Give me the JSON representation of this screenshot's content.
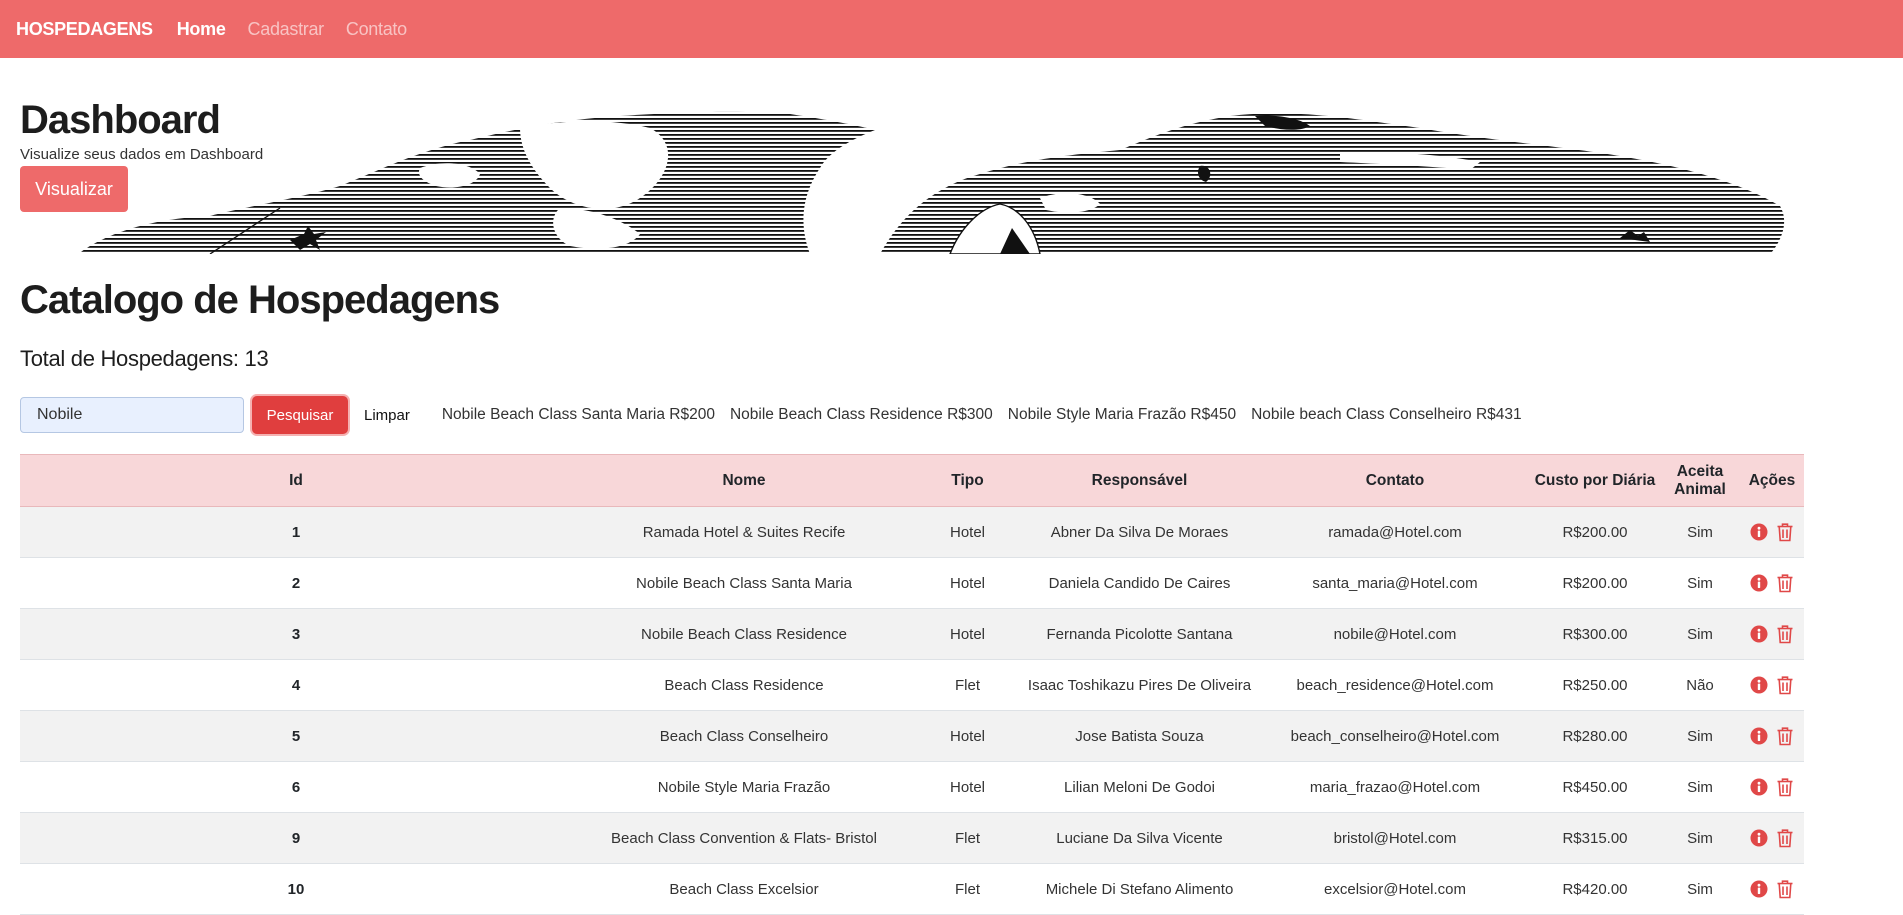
{
  "navbar": {
    "brand": "HOSPEDAGENS",
    "links": [
      {
        "label": "Home",
        "active": true
      },
      {
        "label": "Cadastrar",
        "active": false
      },
      {
        "label": "Contato",
        "active": false
      }
    ]
  },
  "dashboard": {
    "title": "Dashboard",
    "subtitle": "Visualize seus dados em Dashboard",
    "button_label": "Visualizar"
  },
  "catalog": {
    "title": "Catalogo de Hospedagens",
    "total_label": "Total de Hospedagens: 13"
  },
  "search": {
    "value": "Nobile",
    "search_button": "Pesquisar",
    "clear_button": "Limpar",
    "suggestions": [
      "Nobile Beach Class Santa Maria R$200",
      "Nobile Beach Class Residence R$300",
      "Nobile Style Maria Frazão R$450",
      "Nobile beach Class Conselheiro R$431"
    ]
  },
  "table": {
    "headers": [
      "Id",
      "Nome",
      "Tipo",
      "Responsável",
      "Contato",
      "Custo por Diária",
      "Aceita Animal",
      "Ações"
    ],
    "rows": [
      {
        "id": "1",
        "nome": "Ramada Hotel & Suites Recife",
        "tipo": "Hotel",
        "responsavel": "Abner Da Silva De Moraes",
        "contato": "ramada@Hotel.com",
        "custo": "R$200.00",
        "animal": "Sim"
      },
      {
        "id": "2",
        "nome": "Nobile Beach Class Santa Maria",
        "tipo": "Hotel",
        "responsavel": "Daniela Candido De Caires",
        "contato": "santa_maria@Hotel.com",
        "custo": "R$200.00",
        "animal": "Sim"
      },
      {
        "id": "3",
        "nome": "Nobile Beach Class Residence",
        "tipo": "Hotel",
        "responsavel": "Fernanda Picolotte Santana",
        "contato": "nobile@Hotel.com",
        "custo": "R$300.00",
        "animal": "Sim"
      },
      {
        "id": "4",
        "nome": "Beach Class Residence",
        "tipo": "Flet",
        "responsavel": "Isaac Toshikazu Pires De Oliveira",
        "contato": "beach_residence@Hotel.com",
        "custo": "R$250.00",
        "animal": "Não"
      },
      {
        "id": "5",
        "nome": "Beach Class Conselheiro",
        "tipo": "Hotel",
        "responsavel": "Jose Batista Souza",
        "contato": "beach_conselheiro@Hotel.com",
        "custo": "R$280.00",
        "animal": "Sim"
      },
      {
        "id": "6",
        "nome": "Nobile Style Maria Frazão",
        "tipo": "Hotel",
        "responsavel": "Lilian Meloni De Godoi",
        "contato": "maria_frazao@Hotel.com",
        "custo": "R$450.00",
        "animal": "Sim"
      },
      {
        "id": "9",
        "nome": "Beach Class Convention & Flats- Bristol",
        "tipo": "Flet",
        "responsavel": "Luciane Da Silva Vicente",
        "contato": "bristol@Hotel.com",
        "custo": "R$315.00",
        "animal": "Sim"
      },
      {
        "id": "10",
        "nome": "Beach Class Excelsior",
        "tipo": "Flet",
        "responsavel": "Michele Di Stefano Alimento",
        "contato": "excelsior@Hotel.com",
        "custo": "R$420.00",
        "animal": "Sim"
      }
    ]
  },
  "icons": {
    "info": "info-icon",
    "delete": "trash-icon",
    "hero_art": "coastline-sketch-illustration"
  },
  "colors": {
    "navbar": "#ee6a6a",
    "search_button": "#e03e3e",
    "table_header": "#f8d7d9",
    "action_icon": "#e04848"
  }
}
